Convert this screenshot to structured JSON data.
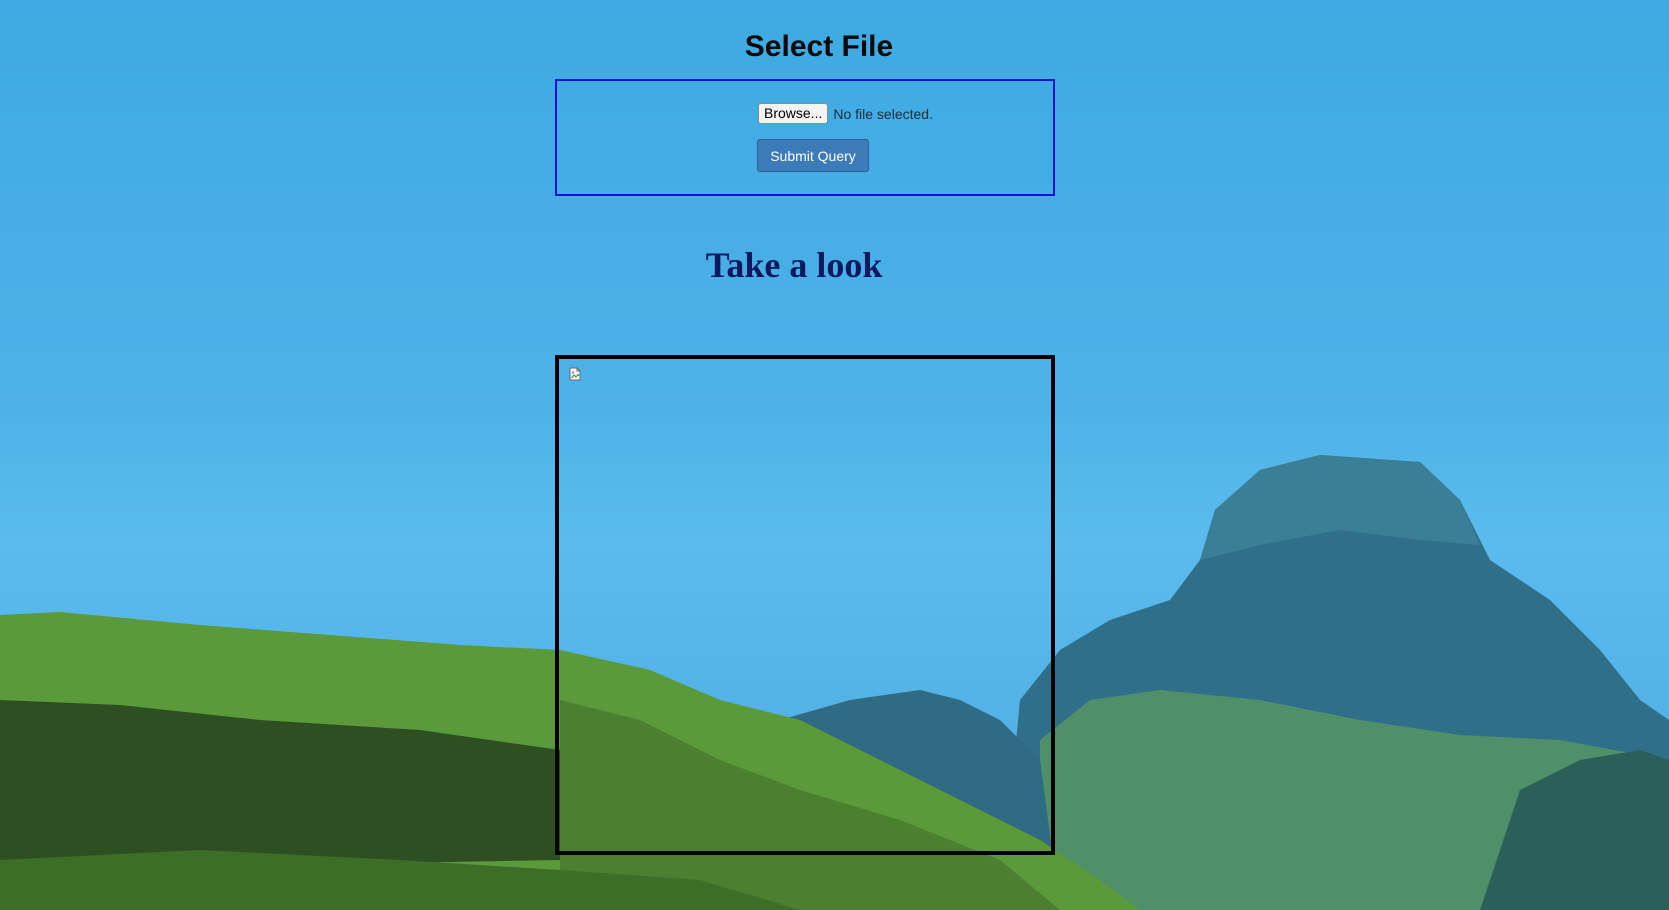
{
  "page": {
    "title": "Select File",
    "section_title": "Take a look"
  },
  "upload_form": {
    "browse_label": "Browse...",
    "file_status": "No file selected.",
    "submit_label": "Submit Query"
  },
  "preview": {
    "image_state": "broken-image-icon"
  },
  "colors": {
    "form_border": "#1010e0",
    "submit_button": "#3d7ab8",
    "section_title": "#0b1a5e",
    "preview_border": "#000000"
  }
}
